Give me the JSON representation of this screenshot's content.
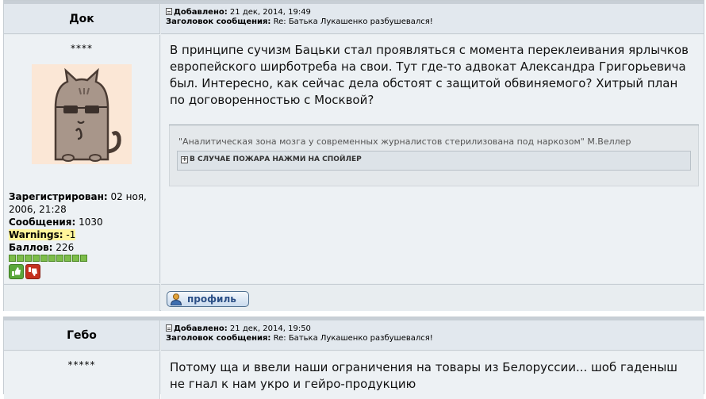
{
  "posts": [
    {
      "author": "Док",
      "meta": {
        "added_label": "Добавлено:",
        "added_value": "21 дек, 2014, 19:49",
        "subject_label": "Заголовок сообщения:",
        "subject_value": "Re: Батька Лукашенко разбушевался!"
      },
      "rank": "****",
      "info": {
        "registered_label": "Зарегистрирован:",
        "registered_value": "02 ноя, 2006, 21:28",
        "messages_label": "Сообщения:",
        "messages_value": "1030",
        "warnings_label": "Warnings:",
        "warnings_value": "-1",
        "points_label": "Баллов:",
        "points_value": "226"
      },
      "body": "В принципе сучизм Бацьки стал проявляться с момента переклеивания ярлычков европейского ширботреба на свои. Тут где-то адвокат Александра Григорьевича был. Интересно, как сейчас дела обстоят с защитой обвиняемого? Хитрый план по договоренностью с Москвой?",
      "signature_quote": "\"Аналитическая зона мозга у современных журналистов стерилизована под наркозом\" М.Веллер",
      "spoiler_label": "В СЛУЧАЕ ПОЖАРА НАЖМИ НА СПОЙЛЕР",
      "profile_button": "профиль"
    },
    {
      "author": "Гебо",
      "meta": {
        "added_label": "Добавлено:",
        "added_value": "21 дек, 2014, 19:50",
        "subject_label": "Заголовок сообщения:",
        "subject_value": "Re: Батька Лукашенко разбушевался!"
      },
      "rank": "*****",
      "body": "Потому ща и ввели наши ограничения на товары из Белоруссии... шоб гаденыш не гнал к нам укро и гейро-продукцию"
    }
  ],
  "icons": {
    "post_icon": "document-icon",
    "vote_up": "thumbs-up-icon",
    "vote_down": "thumbs-down-icon",
    "spoiler": "plus-box-icon",
    "avatar": "pusheen-cat-sunglasses"
  },
  "colors": {
    "header_bg": "#e2e8ee",
    "body_bg": "#edf1f4",
    "warning_highlight": "#fff59a",
    "rating_pip": "#7dbd4a"
  },
  "rating_pips": 10
}
